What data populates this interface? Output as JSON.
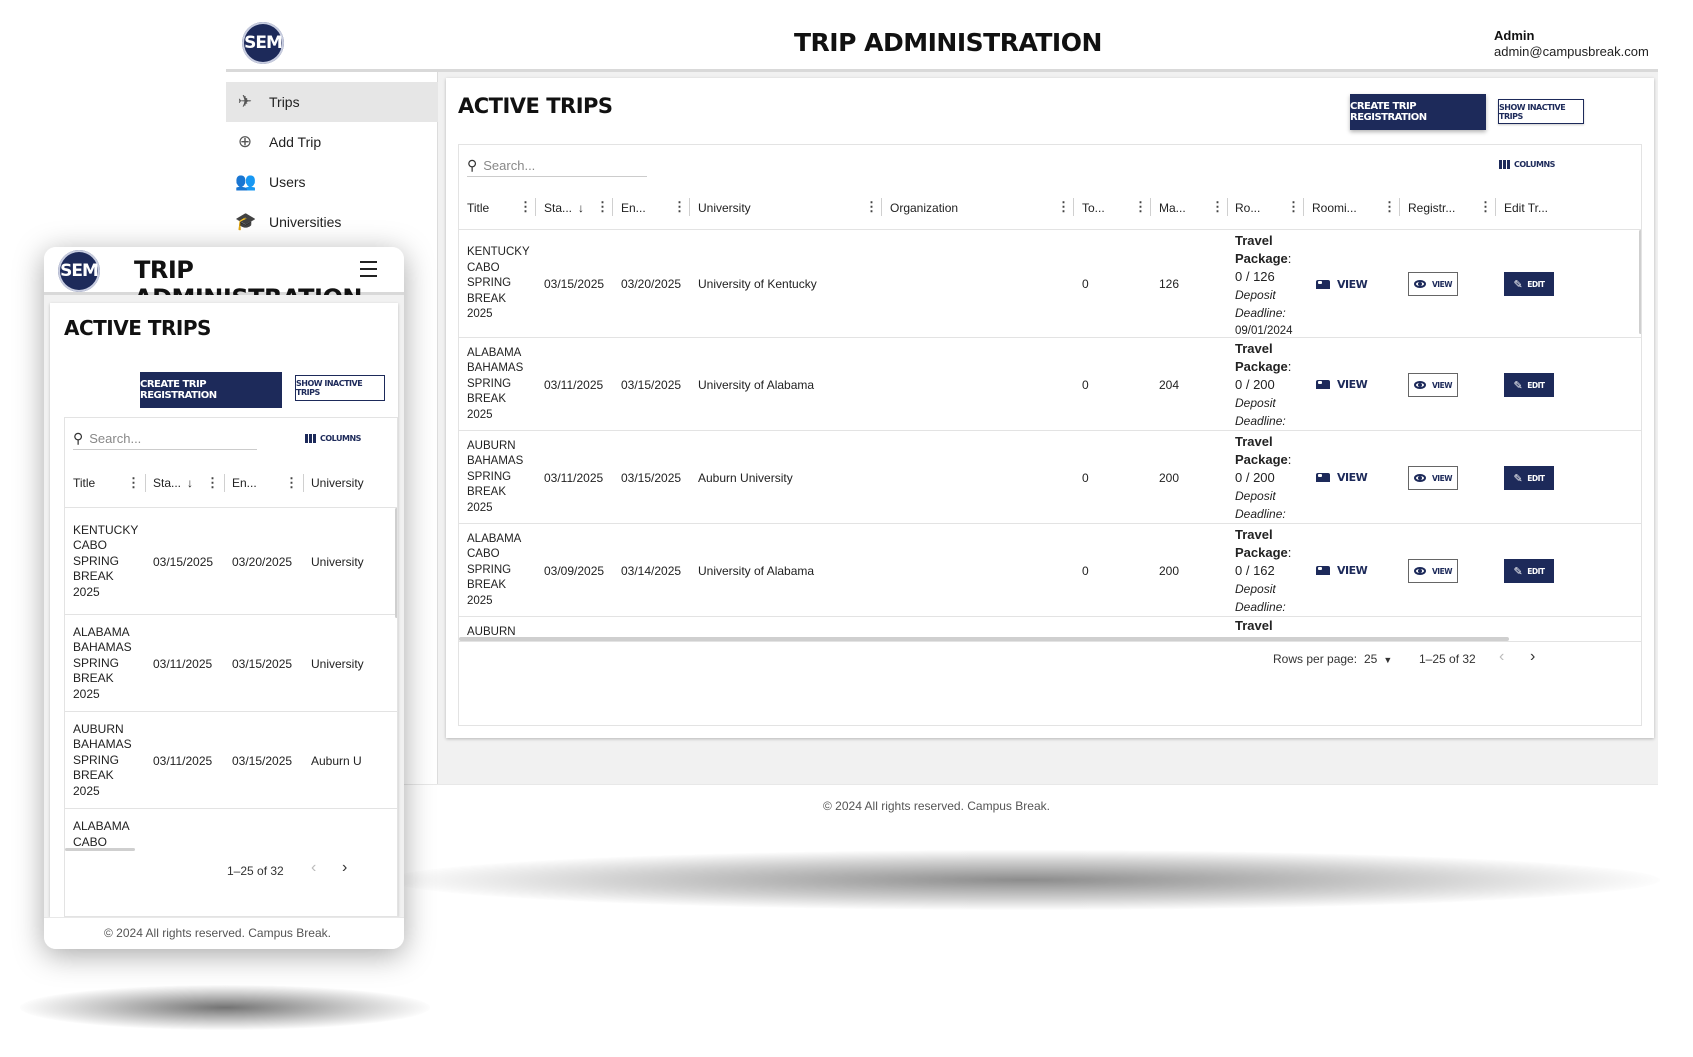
{
  "desktop": {
    "header": {
      "logo_text": "SEM",
      "title": "TRIP ADMINISTRATION",
      "admin_name": "Admin",
      "admin_email": "admin@campusbreak.com"
    },
    "sidebar": {
      "items": [
        {
          "label": "Trips",
          "icon": "airplane-icon",
          "active": true
        },
        {
          "label": "Add Trip",
          "icon": "add-circle-icon",
          "active": false
        },
        {
          "label": "Users",
          "icon": "users-icon",
          "active": false
        },
        {
          "label": "Universities",
          "icon": "school-icon",
          "active": false
        }
      ]
    },
    "main": {
      "heading": "ACTIVE TRIPS",
      "create_button": "CREATE TRIP REGISTRATION",
      "inactive_button": "SHOW INACTIVE TRIPS",
      "search_placeholder": "Search...",
      "columns_button": "COLUMNS",
      "columns": [
        "Title",
        "Sta...",
        "En...",
        "University",
        "Organization",
        "To...",
        "Ma...",
        "Ro...",
        "Roomi...",
        "Registr...",
        "Edit Tr..."
      ],
      "rows": [
        {
          "title": "KENTUCKY\nCABO\nSPRING\nBREAK\n2025",
          "start": "03/15/2025",
          "end": "03/20/2025",
          "university": "University of Kentucky",
          "organization": "",
          "total": "0",
          "max": "126",
          "travel_label": "Travel",
          "package_label": "Package",
          "package_count": "0 / 126",
          "deposit_label": "Deposit",
          "deadline_label": "Deadline:",
          "deadline_date": "09/01/2024",
          "rooming": "VIEW",
          "registration": "VIEW",
          "edit": "EDIT"
        },
        {
          "title": "ALABAMA\nBAHAMAS\nSPRING\nBREAK\n2025",
          "start": "03/11/2025",
          "end": "03/15/2025",
          "university": "University of Alabama",
          "organization": "",
          "total": "0",
          "max": "204",
          "travel_label": "Travel",
          "package_label": "Package",
          "package_count": "0 / 200",
          "deposit_label": "Deposit",
          "deadline_label": "Deadline:",
          "deadline_date": "",
          "rooming": "VIEW",
          "registration": "VIEW",
          "edit": "EDIT"
        },
        {
          "title": "AUBURN\nBAHAMAS\nSPRING\nBREAK\n2025",
          "start": "03/11/2025",
          "end": "03/15/2025",
          "university": "Auburn University",
          "organization": "",
          "total": "0",
          "max": "200",
          "travel_label": "Travel",
          "package_label": "Package",
          "package_count": "0 / 200",
          "deposit_label": "Deposit",
          "deadline_label": "Deadline:",
          "deadline_date": "",
          "rooming": "VIEW",
          "registration": "VIEW",
          "edit": "EDIT"
        },
        {
          "title": "ALABAMA\nCABO\nSPRING\nBREAK\n2025",
          "start": "03/09/2025",
          "end": "03/14/2025",
          "university": "University of Alabama",
          "organization": "",
          "total": "0",
          "max": "200",
          "travel_label": "Travel",
          "package_label": "Package",
          "package_count": "0 / 162",
          "deposit_label": "Deposit",
          "deadline_label": "Deadline:",
          "deadline_date": "",
          "rooming": "VIEW",
          "registration": "VIEW",
          "edit": "EDIT"
        },
        {
          "title": "AUBURN",
          "start": "",
          "end": "",
          "university": "",
          "organization": "",
          "total": "",
          "max": "",
          "travel_label": "Travel",
          "package_label": "",
          "package_count": "",
          "deposit_label": "",
          "deadline_label": "",
          "deadline_date": "",
          "rooming": "",
          "registration": "",
          "edit": ""
        }
      ],
      "pagination": {
        "rows_per_page_label": "Rows per page:",
        "rows_per_page_value": "25",
        "range": "1–25 of 32"
      }
    },
    "footer": "© 2024 All rights reserved. Campus Break."
  },
  "mobile": {
    "header": {
      "logo_text": "SEM",
      "title": "TRIP ADMINISTRATION"
    },
    "heading": "ACTIVE TRIPS",
    "create_button": "CREATE TRIP REGISTRATION",
    "inactive_button": "SHOW INACTIVE TRIPS",
    "search_placeholder": "Search...",
    "columns_button": "COLUMNS",
    "columns": [
      "Title",
      "Sta...",
      "En...",
      "University"
    ],
    "rows": [
      {
        "title": "KENTUCKY\nCABO\nSPRING\nBREAK\n2025",
        "start": "03/15/2025",
        "end": "03/20/2025",
        "university": "University"
      },
      {
        "title": "ALABAMA\nBAHAMAS\nSPRING\nBREAK\n2025",
        "start": "03/11/2025",
        "end": "03/15/2025",
        "university": "University"
      },
      {
        "title": "AUBURN\nBAHAMAS\nSPRING\nBREAK\n2025",
        "start": "03/11/2025",
        "end": "03/15/2025",
        "university": "Auburn U"
      },
      {
        "title": "ALABAMA\nCABO",
        "start": "",
        "end": "",
        "university": ""
      }
    ],
    "pagination": {
      "range": "1–25 of 32"
    },
    "footer": "© 2024 All rights reserved. Campus Break."
  },
  "colors": {
    "brand_navy": "#1d2a5a",
    "background_gray": "#f1f1f1"
  }
}
